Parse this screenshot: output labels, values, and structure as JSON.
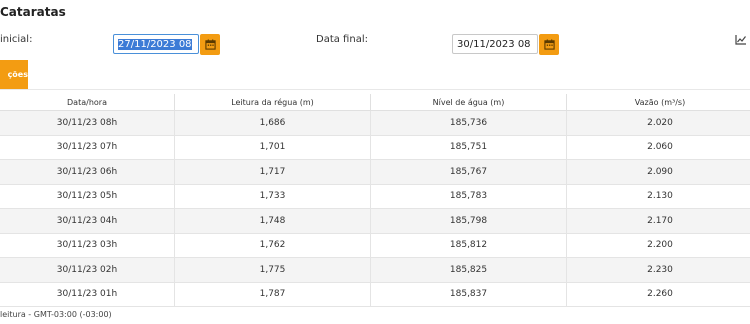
{
  "page": {
    "title": "Cataratas"
  },
  "filters": {
    "start_label": "inicial:",
    "start_value": "27/11/2023 08",
    "end_label": "Data final:",
    "end_value": "30/11/2023 08"
  },
  "tab": {
    "label": "ções"
  },
  "table": {
    "headers": [
      "Data/hora",
      "Leitura da régua (m)",
      "Nível de água (m)",
      "Vazão (m³/s)"
    ],
    "rows": [
      [
        "30/11/23 08h",
        "1,686",
        "185,736",
        "2.020"
      ],
      [
        "30/11/23 07h",
        "1,701",
        "185,751",
        "2.060"
      ],
      [
        "30/11/23 06h",
        "1,717",
        "185,767",
        "2.090"
      ],
      [
        "30/11/23 05h",
        "1,733",
        "185,783",
        "2.130"
      ],
      [
        "30/11/23 04h",
        "1,748",
        "185,798",
        "2.170"
      ],
      [
        "30/11/23 03h",
        "1,762",
        "185,812",
        "2.200"
      ],
      [
        "30/11/23 02h",
        "1,775",
        "185,825",
        "2.230"
      ],
      [
        "30/11/23 01h",
        "1,787",
        "185,837",
        "2.260"
      ]
    ]
  },
  "footer": {
    "note": "leitura - GMT-03:00 (-03:00)"
  },
  "colors": {
    "accent": "#f39c12",
    "selection": "#3c7bd6"
  },
  "icons": {
    "calendar": "calendar-icon",
    "chart": "line-chart-icon"
  }
}
